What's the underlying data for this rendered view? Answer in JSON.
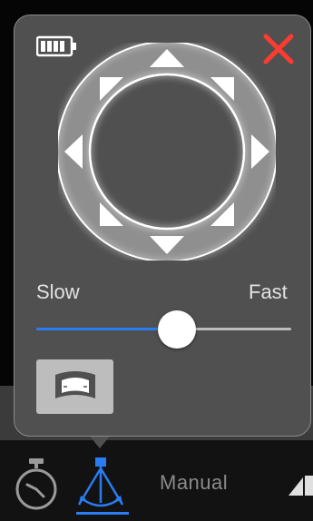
{
  "colors": {
    "accent": "#2a7cf0",
    "close": "#ff3b30",
    "panel_bg": "#505050",
    "panel_border": "#8a8a8a",
    "ring": "#8f8f8f",
    "arrow": "#ffffff",
    "mode_button_bg": "#bdbdbd",
    "inactive_text": "#8a8a8a"
  },
  "panel": {
    "battery_icon": "battery-full-icon",
    "battery_level": 1.0,
    "close_icon": "close-x-icon",
    "dpad": {
      "icon": "directional-pad",
      "arrows": [
        "up",
        "up-right",
        "right",
        "down-right",
        "down",
        "down-left",
        "left",
        "up-left"
      ]
    },
    "speed": {
      "label_slow": "Slow",
      "label_fast": "Fast",
      "value": 0.55
    },
    "mode_button": {
      "icon": "panorama-rotate-icon"
    }
  },
  "bottom_bar": {
    "timer_icon": "stopwatch-icon",
    "pan_icon": "pan-tilt-rig-icon",
    "mode_label": "Manual",
    "speed_icon": "speed-ramp-icon"
  }
}
